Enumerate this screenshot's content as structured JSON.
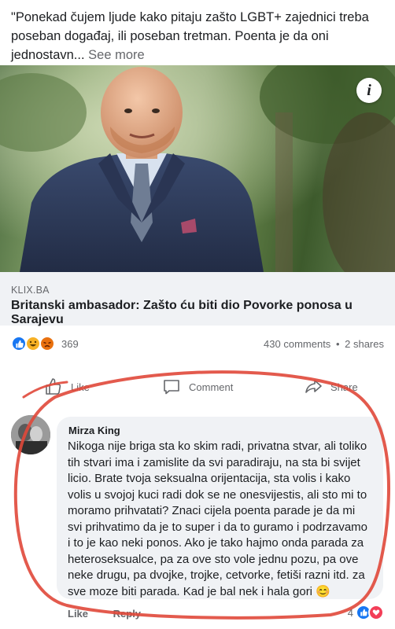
{
  "post": {
    "text": "\"Ponekad čujem ljude kako pitaju zašto LGBT+ zajednici treba poseban događaj, ili poseban tretman.  Poenta je da oni jednostavn...",
    "see_more": "See more"
  },
  "link": {
    "source": "KLIX.BA",
    "title": "Britanski ambasador: Zašto ću biti dio Povorke ponosa u Sarajevu"
  },
  "reactions": {
    "icons": [
      "like-icon",
      "haha-icon",
      "angry-icon"
    ],
    "count": "369",
    "comments": "430 comments",
    "separator": "•",
    "shares": "2 shares"
  },
  "actions": {
    "like": "Like",
    "comment": "Comment",
    "share": "Share"
  },
  "comment": {
    "author": "Mirza King",
    "body": "Nikoga nije briga sta ko skim radi, privatna stvar, ali toliko tih stvari ima i zamislite da svi paradiraju, na sta bi svijet licio. Brate tvoja seksualna orijentacija, sta volis i kako volis u svojoj kuci radi dok se ne onesvijestis, ali sto mi to moramo prihvatati? Znaci cijela poenta parade je da mi svi prihvatimo da je to super i da to guramo i podrzavamo i to je kao neki ponos. Ako je tako hajmo onda parada za heteroseksualce, pa za ove sto vole jednu pozu, pa ove neke drugu, pa dvojke, trojke, cetvorke, fetiši razni itd. za sve moze biti parada. Kad je bal nek i hala gori 😊",
    "like_label": "Like",
    "reply_label": "Reply",
    "reaction_count": "4"
  },
  "colors": {
    "accent": "#1877f2",
    "annotation": "#e0483a"
  }
}
